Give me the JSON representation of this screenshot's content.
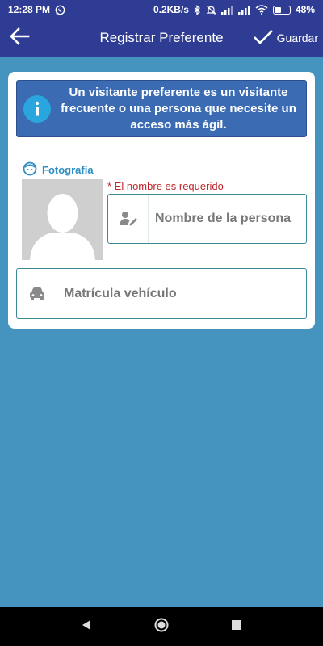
{
  "status": {
    "time": "12:28 PM",
    "network_speed": "0.2KB/s",
    "battery": "48%",
    "battery_level": 0.48,
    "icons": [
      "whatsapp-icon",
      "bluetooth-icon",
      "mute-icon",
      "signal-icon",
      "wifi-icon"
    ]
  },
  "appbar": {
    "title": "Registrar Preferente",
    "save_label": "Guardar"
  },
  "info": {
    "message": "Un visitante preferente es un visitante frecuente o una persona que necesite un acceso más ágil."
  },
  "photo": {
    "label": "Fotografía"
  },
  "form": {
    "name_error": "* El nombre es requerido",
    "name_placeholder": "Nombre de la persona",
    "plate_placeholder": "Matrícula vehículo"
  },
  "colors": {
    "appbar": "#2f3c94",
    "background": "#4593bf",
    "info_box": "#3b6bb3",
    "accent": "#2f8fc4",
    "error": "#c0272d"
  }
}
